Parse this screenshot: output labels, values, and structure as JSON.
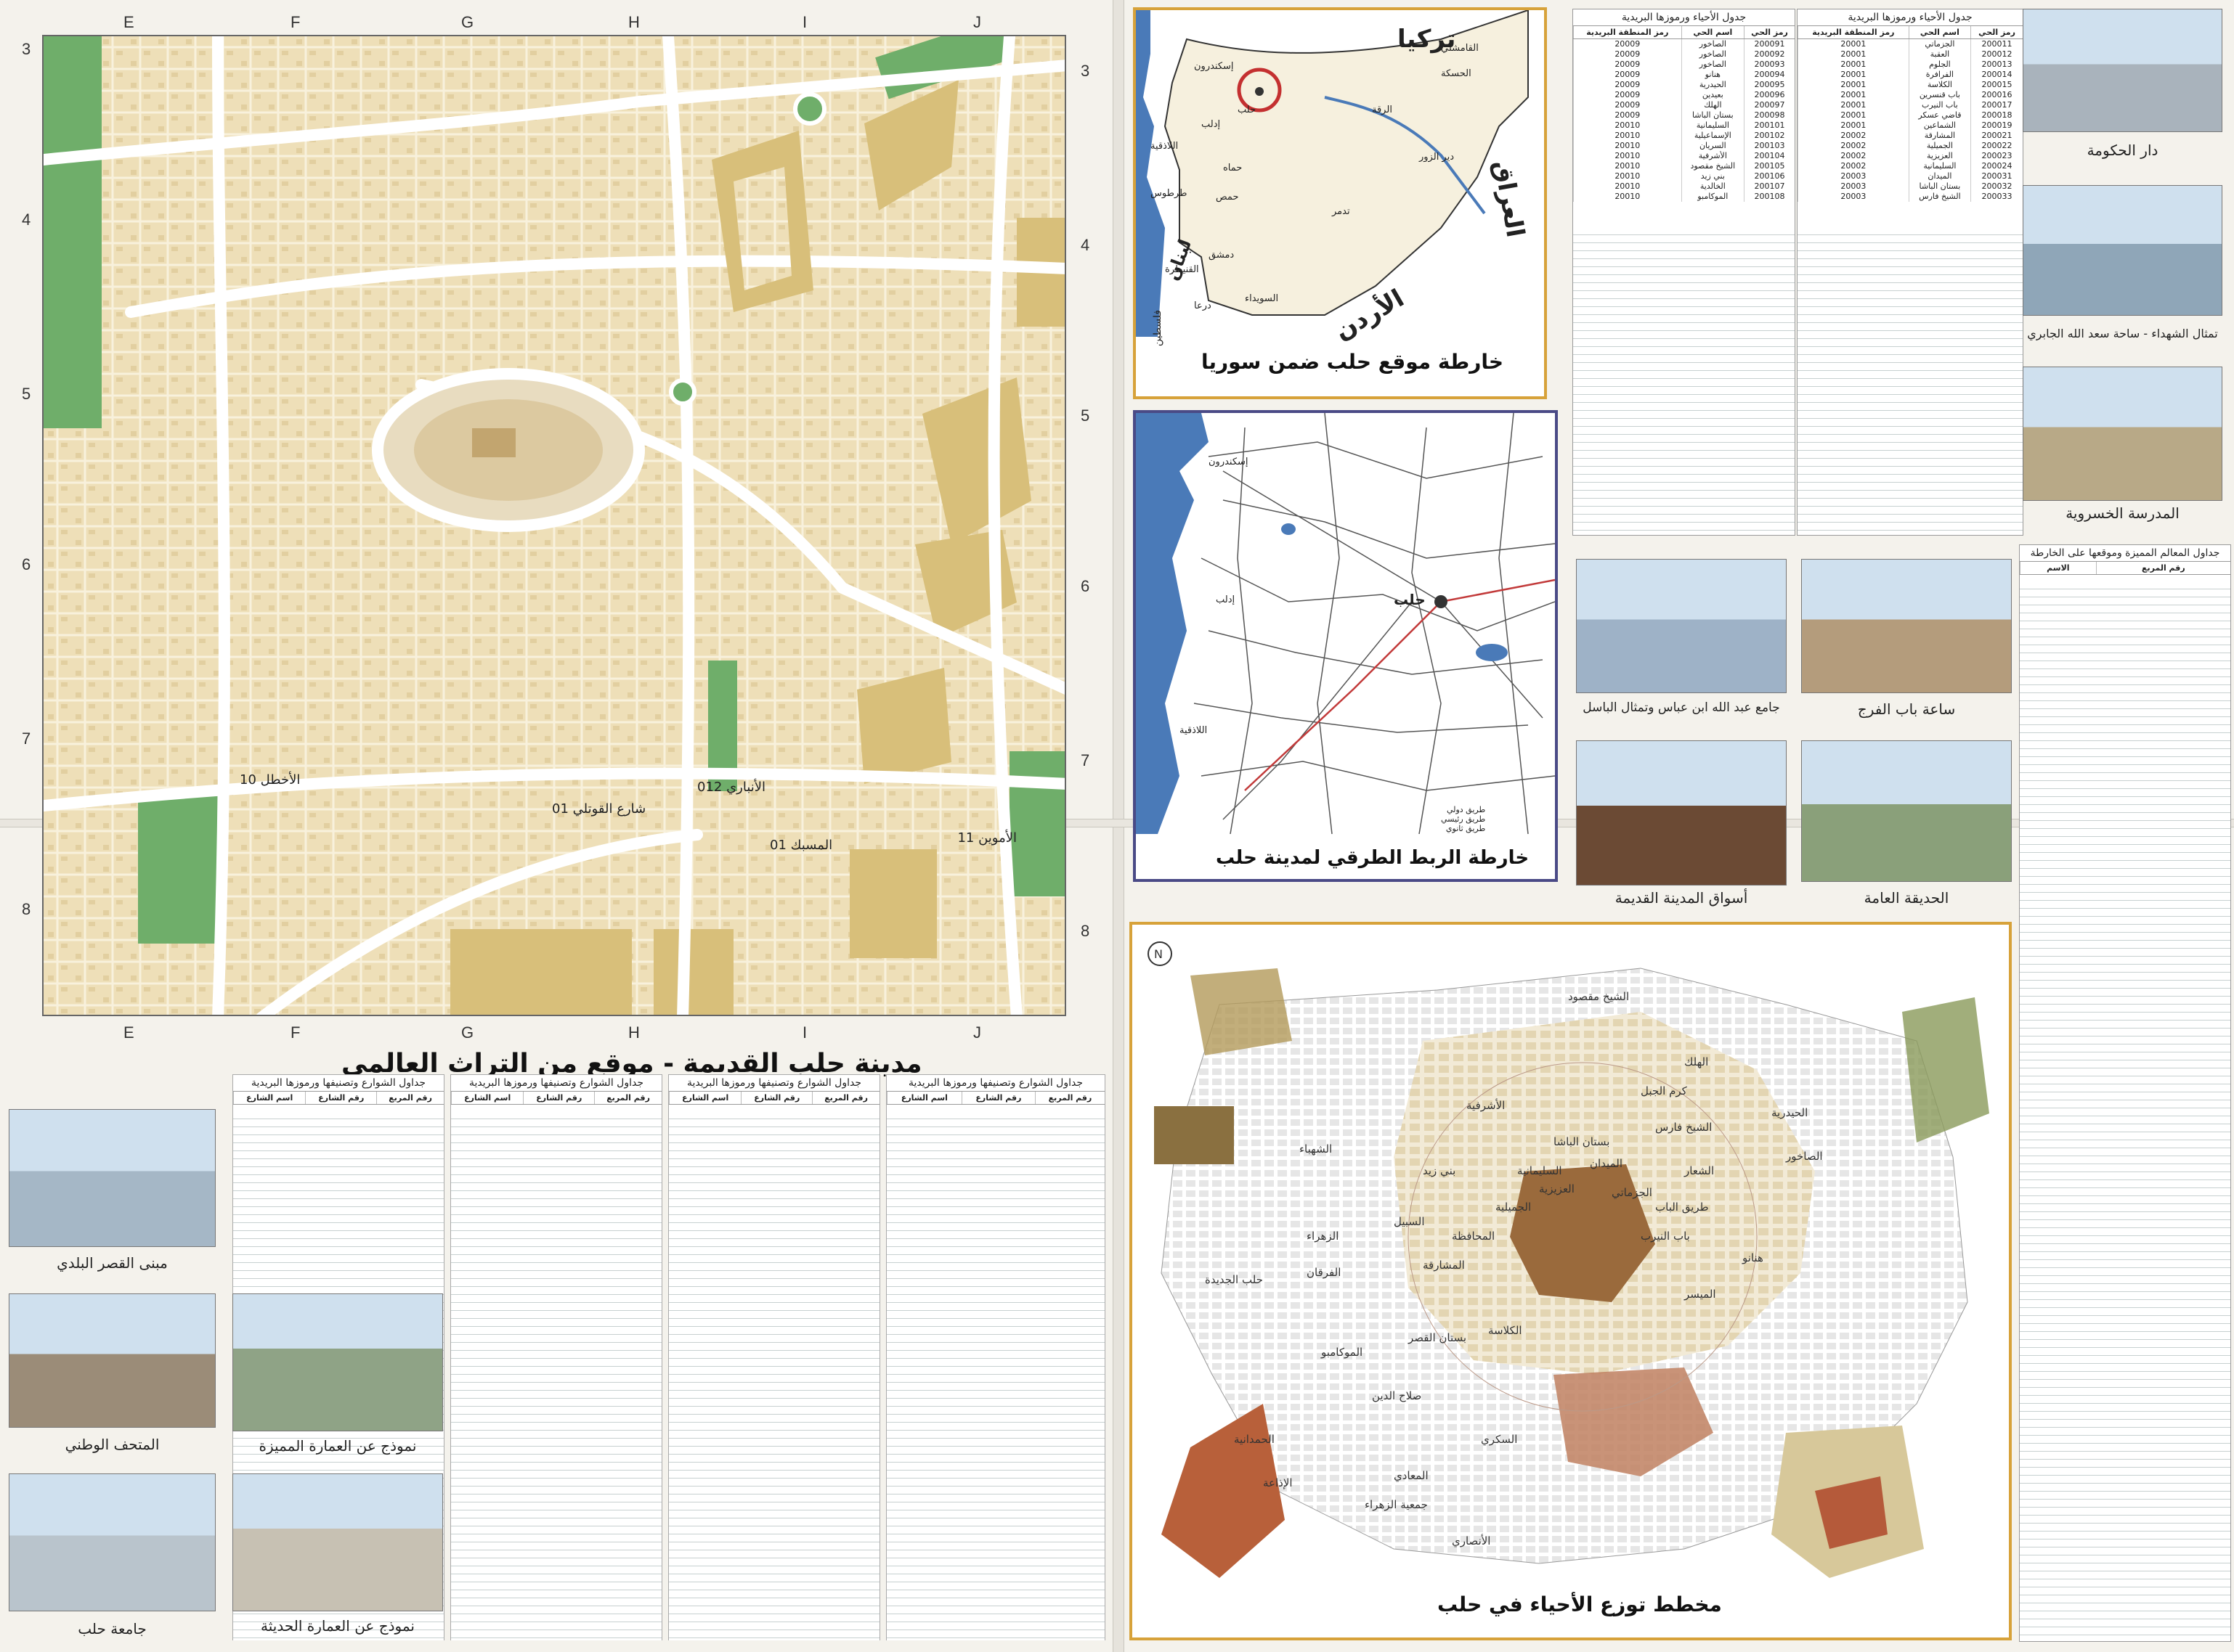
{
  "old_city_map": {
    "title": "مدينة حلب القديمة - موقع من التراث العالمي",
    "col_labels": [
      "E",
      "F",
      "G",
      "H",
      "I",
      "J"
    ],
    "row_labels_left": [
      "3",
      "4",
      "5",
      "6",
      "7",
      "8"
    ],
    "row_labels_right": [
      "3",
      "4",
      "5",
      "6",
      "7",
      "8"
    ],
    "street_labels": [
      "الأموين 11",
      "الأخطل 10",
      "شارع القوتلي 01",
      "المسبك 01",
      "012 الأنباري"
    ],
    "colors": {
      "base": "#eedfb8",
      "road": "#ffffff",
      "green": "#6fae6a",
      "block": "#d8bf7a"
    }
  },
  "syria_map": {
    "title": "خارطة موقع حلب ضمن سوريا",
    "countries": {
      "turkey": "تركيا",
      "iraq": "العراق",
      "jordan": "الأردن",
      "lebanon": "لبنان",
      "palestine": "فلسطين"
    },
    "cities": [
      "حلب",
      "القامشلي",
      "الحسكة",
      "الرقة",
      "دير الزور",
      "تدمر",
      "حمص",
      "حماه",
      "إدلب",
      "اللاذقية",
      "طرطوس",
      "دمشق",
      "السويداء",
      "درعا",
      "القنيطرة",
      "إسكندرون"
    ]
  },
  "roads_map": {
    "title": "خارطة الربط الطرقي لمدينة حلب",
    "cities": [
      "حلب",
      "إسكندرون",
      "اللاذقية",
      "إدلب"
    ],
    "legend": [
      "طريق دولي",
      "طريق رئيسي",
      "طريق ثانوي"
    ]
  },
  "districts_map": {
    "title": "مخطط توزع الأحياء في حلب",
    "north_label": "N",
    "districts": [
      "الشيخ مقصود",
      "الأشرفية",
      "بني زيد",
      "الحيدرية",
      "الشيخ فارس",
      "بستان الباشا",
      "الميدان",
      "السليمانية",
      "العزيزية",
      "الجميلية",
      "حلب الجديدة",
      "الحمدانية",
      "صلاح الدين",
      "الشعار",
      "المشارقة",
      "السبيل",
      "الفرقان",
      "الشهباء",
      "الموكامبو",
      "الإذاعة",
      "السكري",
      "الأنصاري",
      "الهلك",
      "الصاخور",
      "هنانو",
      "الجزماتي",
      "المحافظة",
      "الكلاسة",
      "باب النيرب",
      "الميسر",
      "طريق الباب",
      "كرم الجبل",
      "الزهراء",
      "المعادي",
      "جمعية الزهراء",
      "بستان القصر"
    ]
  },
  "district_codes_table": {
    "title": "جدول الأحياء ورموزها البريدية",
    "headers": [
      "رمز الحي",
      "اسم الحي",
      "رمز المنطقة البريدية"
    ],
    "rows": [
      [
        "200011",
        "الجزماتي",
        "20001"
      ],
      [
        "200012",
        "العقبة",
        "20001"
      ],
      [
        "200013",
        "الجلوم",
        "20001"
      ],
      [
        "200014",
        "الفرافرة",
        "20001"
      ],
      [
        "200015",
        "الكلاسة",
        "20001"
      ],
      [
        "200016",
        "باب قنسرين",
        "20001"
      ],
      [
        "200017",
        "باب النيرب",
        "20001"
      ],
      [
        "200018",
        "قاضي عسكر",
        "20001"
      ],
      [
        "200019",
        "الشماعين",
        "20001"
      ],
      [
        "200021",
        "المشارقة",
        "20002"
      ],
      [
        "200022",
        "الجميلية",
        "20002"
      ],
      [
        "200023",
        "العزيزية",
        "20002"
      ],
      [
        "200024",
        "السليمانية",
        "20002"
      ],
      [
        "200031",
        "الميدان",
        "20003"
      ],
      [
        "200032",
        "بستان الباشا",
        "20003"
      ],
      [
        "200033",
        "الشيخ فارس",
        "20003"
      ]
    ]
  },
  "district_codes_table_2": {
    "title": "جدول الأحياء ورموزها البريدية",
    "headers": [
      "رمز الحي",
      "اسم الحي",
      "رمز المنطقة البريدية"
    ],
    "rows": [
      [
        "200091",
        "الصاخور",
        "20009"
      ],
      [
        "200092",
        "الصاخور",
        "20009"
      ],
      [
        "200093",
        "الصاخور",
        "20009"
      ],
      [
        "200094",
        "هنانو",
        "20009"
      ],
      [
        "200095",
        "الحيدرية",
        "20009"
      ],
      [
        "200096",
        "بعيدين",
        "20009"
      ],
      [
        "200097",
        "الهلك",
        "20009"
      ],
      [
        "200098",
        "بستان الباشا",
        "20009"
      ],
      [
        "200101",
        "السليمانية",
        "20010"
      ],
      [
        "200102",
        "الإسماعيلية",
        "20010"
      ],
      [
        "200103",
        "السريان",
        "20010"
      ],
      [
        "200104",
        "الأشرفية",
        "20010"
      ],
      [
        "200105",
        "الشيخ مقصود",
        "20010"
      ],
      [
        "200106",
        "بني زيد",
        "20010"
      ],
      [
        "200107",
        "الخالدية",
        "20010"
      ],
      [
        "200108",
        "الموكامبو",
        "20010"
      ]
    ]
  },
  "landmarks_table": {
    "title": "جداول المعالم المميزة وموقعها على الخارطة",
    "headers": [
      "رقم المربع",
      "الاسم"
    ]
  },
  "streets_tables": [
    {
      "title": "جداول الشوارع وتصنيفها ورموزها البريدية",
      "headers": [
        "رقم المربع",
        "رقم الشارع",
        "اسم الشارع"
      ]
    },
    {
      "title": "جداول الشوارع وتصنيفها ورموزها البريدية",
      "headers": [
        "رقم المربع",
        "رقم الشارع",
        "اسم الشارع"
      ]
    },
    {
      "title": "جداول الشوارع وتصنيفها ورموزها البريدية",
      "headers": [
        "رقم المربع",
        "رقم الشارع",
        "اسم الشارع"
      ]
    },
    {
      "title": "جداول الشوارع وتصنيفها ورموزها البريدية",
      "headers": [
        "رقم المربع",
        "رقم الشارع",
        "اسم الشارع"
      ]
    }
  ],
  "photos": [
    {
      "caption": "دار الحكومة",
      "color": "#a9b3bc"
    },
    {
      "caption": "تمثال الشهداء - ساحة سعد الله الجابري",
      "color": "#8fa6b8"
    },
    {
      "caption": "المدرسة الخسروية",
      "color": "#b8a987"
    },
    {
      "caption": "ساعة باب الفرج",
      "color": "#b49c7c"
    },
    {
      "caption": "جامع عبد الله ابن عباس وتمثال الباسل",
      "color": "#9eb2c7"
    },
    {
      "caption": "أسواق المدينة القديمة",
      "color": "#6b4a34"
    },
    {
      "caption": "الحديقة العامة",
      "color": "#8aa07a"
    },
    {
      "caption": "مبنى القصر البلدي",
      "color": "#a5b7c6"
    },
    {
      "caption": "المتحف الوطني",
      "color": "#9b8c78"
    },
    {
      "caption": "نموذج عن العمارة المميزة",
      "color": "#8fa386"
    },
    {
      "caption": "جامعة حلب",
      "color": "#b9c4cc"
    },
    {
      "caption": "نموذج عن العمارة الحديثة",
      "color": "#c7c1b3"
    }
  ]
}
